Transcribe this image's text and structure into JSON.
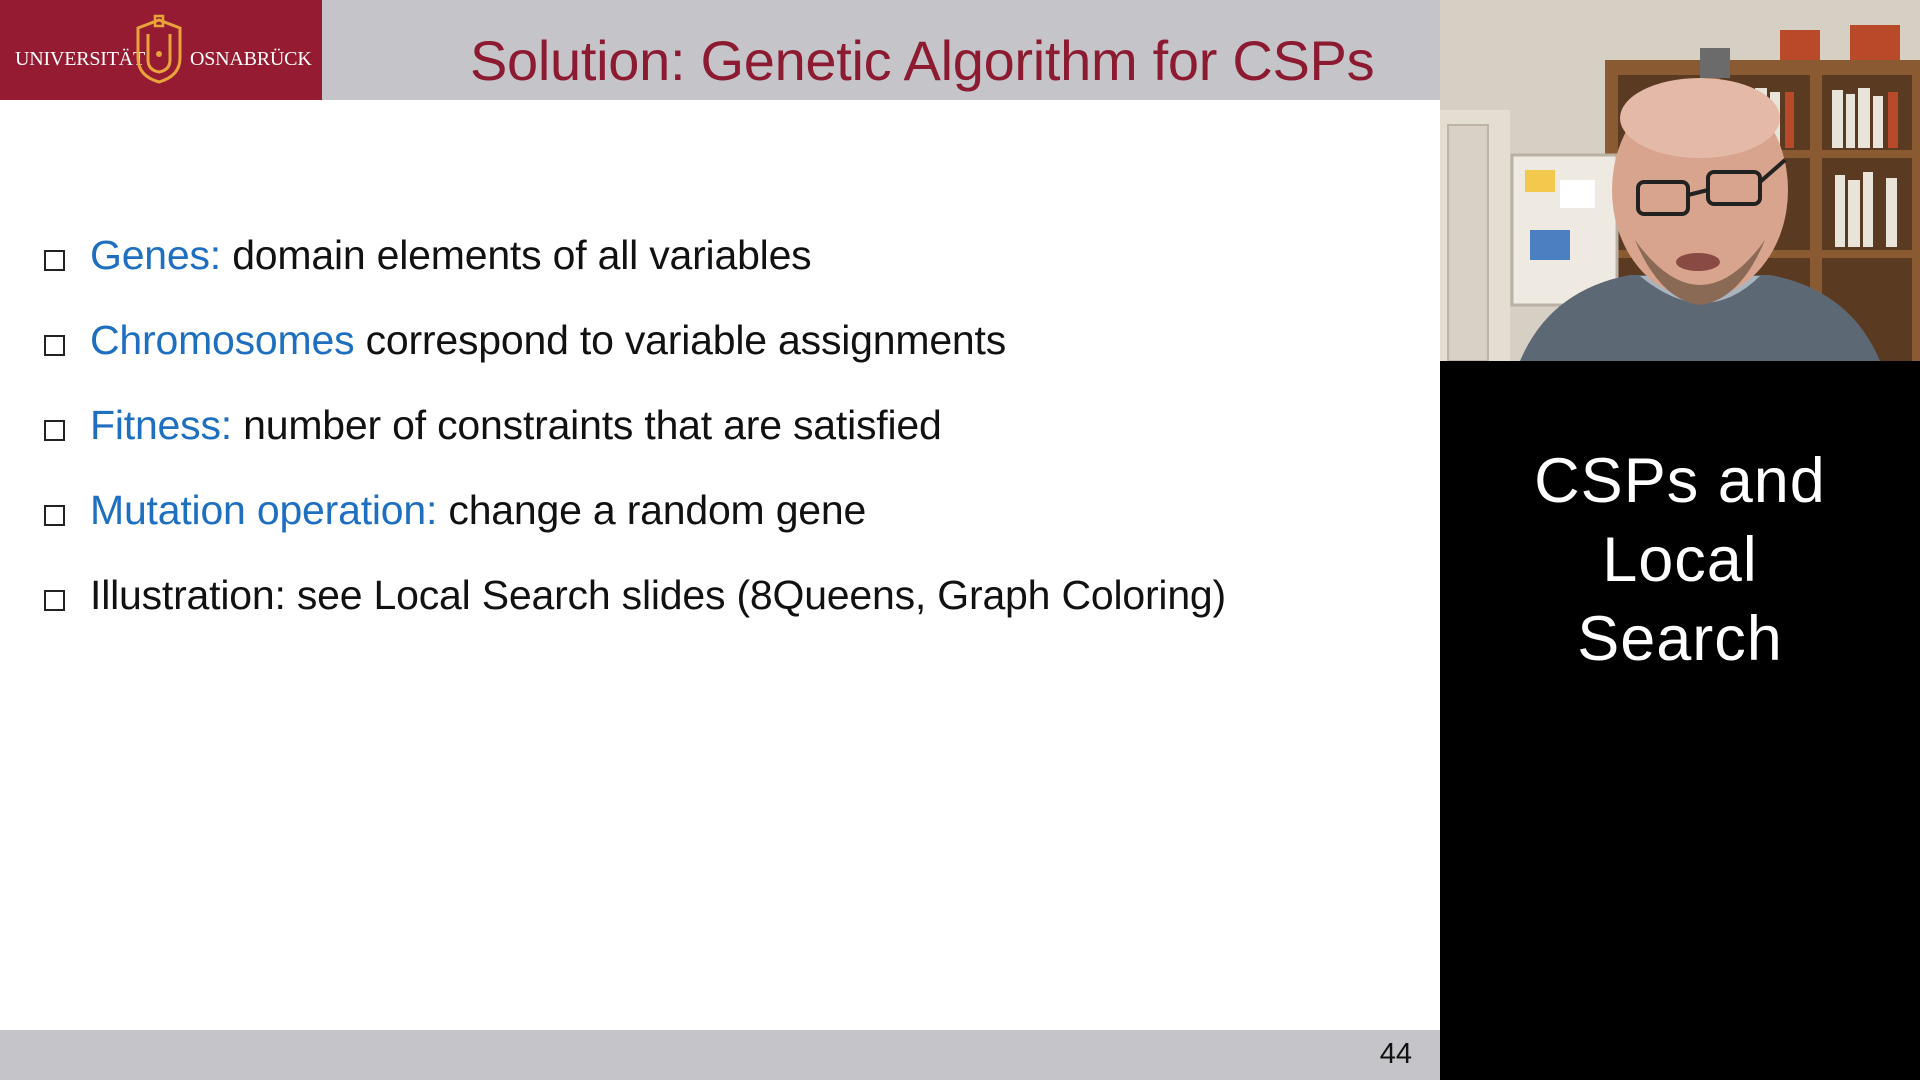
{
  "slide": {
    "logo": {
      "left_word": "UNIVERSITÄT",
      "right_word": "OSNABRÜCK"
    },
    "title": "Solution: Genetic Algorithm for CSPs",
    "bullets": [
      {
        "term": "Genes:",
        "text": " domain elements of all variables"
      },
      {
        "term": "Chromosomes",
        "text": " correspond to variable assignments"
      },
      {
        "term": "Fitness:",
        "text": " number of constraints that are satisfied"
      },
      {
        "term": "Mutation operation:",
        "text": " change a random gene"
      },
      {
        "term": "",
        "text": "Illustration: see Local Search slides (8Queens, Graph Coloring)"
      }
    ],
    "page_number": "44",
    "colors": {
      "title": "#8c1b32",
      "term": "#1f6fc0",
      "logo_bg": "#941b31",
      "bar": "#c5c5c9"
    }
  },
  "side_panel": {
    "title_lines": [
      "CSPs and",
      "Local",
      "Search"
    ],
    "webcam_icon": "presenter-video"
  }
}
